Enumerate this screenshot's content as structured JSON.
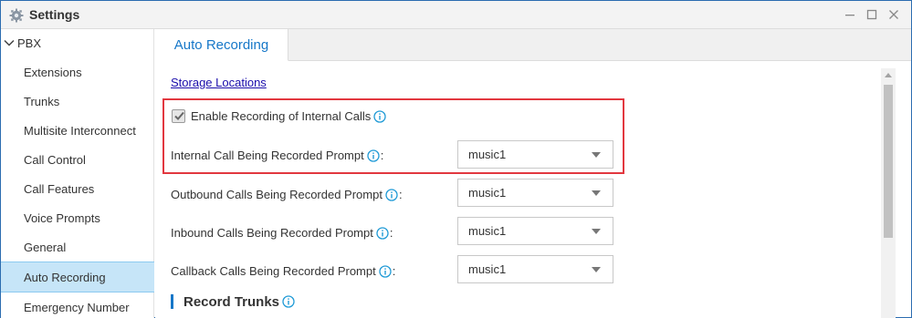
{
  "window": {
    "title": "Settings",
    "icon": "gear-icon",
    "controls": [
      "minimize-icon",
      "maximize-icon",
      "close-icon"
    ]
  },
  "sidebar": {
    "section": "PBX",
    "items": [
      {
        "label": "Extensions"
      },
      {
        "label": "Trunks"
      },
      {
        "label": "Multisite Interconnect"
      },
      {
        "label": "Call Control"
      },
      {
        "label": "Call Features"
      },
      {
        "label": "Voice Prompts"
      },
      {
        "label": "General"
      },
      {
        "label": "Auto Recording",
        "active": true
      },
      {
        "label": "Emergency Number"
      }
    ]
  },
  "tabs": [
    {
      "label": "Auto Recording",
      "active": true
    }
  ],
  "content": {
    "storage_link": "Storage Locations",
    "enable_internal": {
      "label": "Enable Recording of Internal Calls",
      "checked": true
    },
    "prompts": [
      {
        "label": "Internal Call Being Recorded Prompt",
        "value": "music1"
      },
      {
        "label": "Outbound Calls Being Recorded Prompt",
        "value": "music1"
      },
      {
        "label": "Inbound Calls Being Recorded Prompt",
        "value": "music1"
      },
      {
        "label": "Callback Calls Being Recorded Prompt",
        "value": "music1"
      }
    ],
    "section_title": "Record Trunks",
    "colon": ":"
  },
  "colors": {
    "accent": "#1677c8",
    "highlight_border": "#e2373f",
    "active_item_bg": "#c6e5f8"
  }
}
